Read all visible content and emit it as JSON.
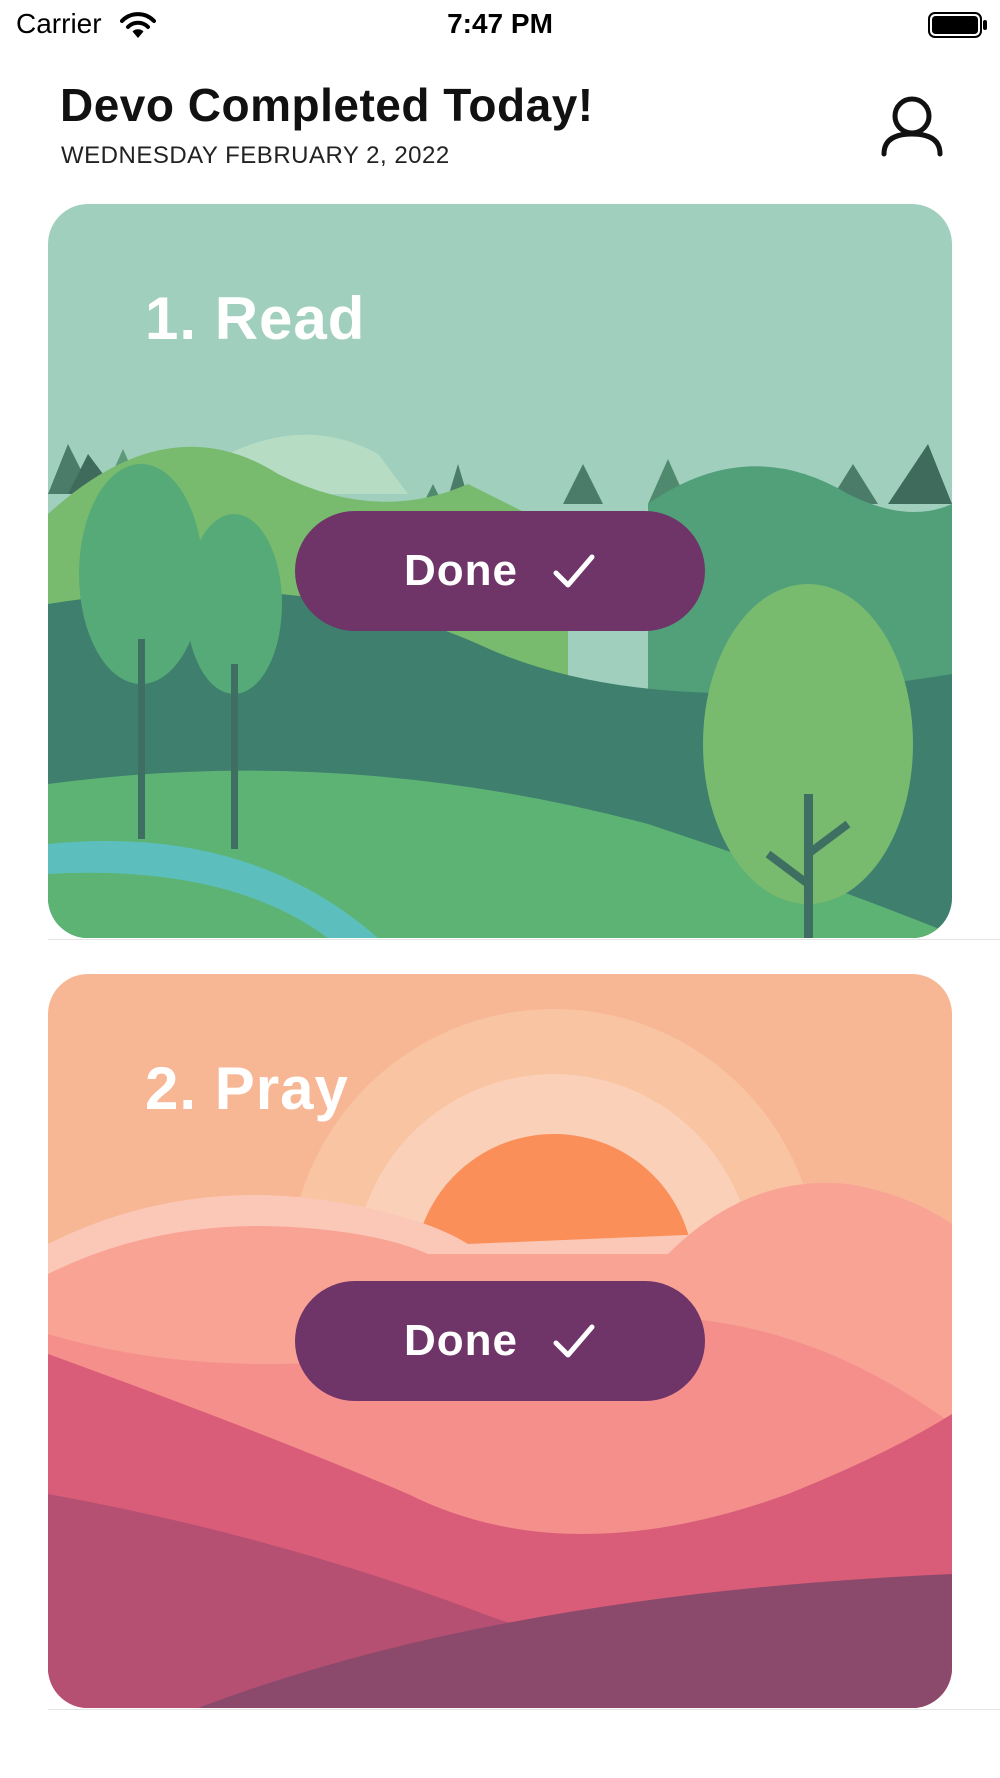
{
  "status_bar": {
    "carrier": "Carrier",
    "time": "7:47 PM"
  },
  "header": {
    "title": "Devo Completed Today!",
    "date": "WEDNESDAY FEBRUARY 2, 2022"
  },
  "cards": [
    {
      "title": "1. Read",
      "button_label": "Done",
      "icon": "checkmark-icon",
      "theme": "green-landscape"
    },
    {
      "title": "2. Pray",
      "button_label": "Done",
      "icon": "checkmark-icon",
      "theme": "sunset-landscape"
    }
  ],
  "colors": {
    "button": "#6f3468",
    "read_sky": "#a0d0bd",
    "pray_sky": "#f8b794"
  }
}
